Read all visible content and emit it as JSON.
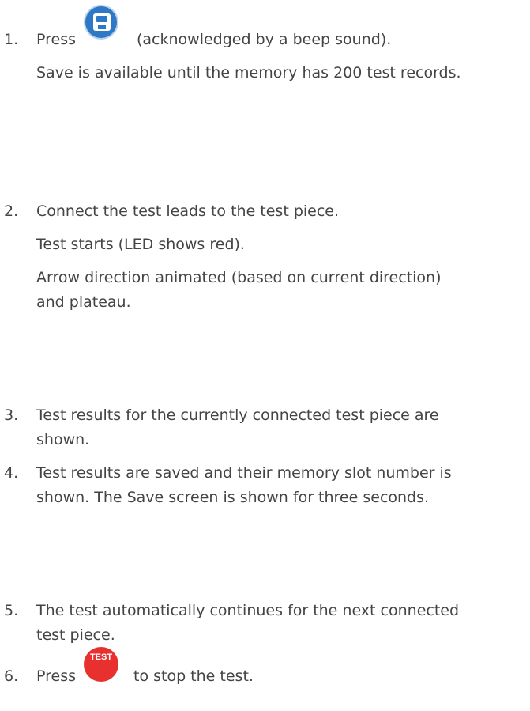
{
  "steps": [
    {
      "number": "1.",
      "before_icon": "Press",
      "icon": "save-icon",
      "after_icon": "(acknowledged by a beep sound).",
      "lines": [
        "Save is available until the memory has 200 test records."
      ]
    },
    {
      "number": "2.",
      "lines": [
        "Connect the test leads to the test piece.",
        "Test starts (LED shows red).",
        "Arrow direction animated (based on current direction)",
        "and plateau."
      ]
    },
    {
      "number": "3.",
      "lines": [
        "Test results for the currently connected test piece are",
        "shown."
      ]
    },
    {
      "number": "4.",
      "lines": [
        "Test results are saved and their memory slot number is",
        "shown. The Save screen is shown for three seconds."
      ]
    },
    {
      "number": "5.",
      "lines": [
        "The test automatically continues for the next connected",
        "test piece."
      ]
    },
    {
      "number": "6.",
      "before_icon": "Press",
      "icon": "test-button-icon",
      "after_icon": "to stop the test.",
      "icon_label": "TEST"
    }
  ],
  "colors": {
    "text": "#444444",
    "save_icon": "#2f78c5",
    "test_icon": "#e8312f"
  }
}
